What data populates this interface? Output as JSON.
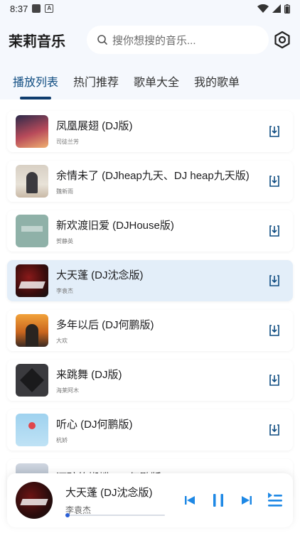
{
  "status": {
    "time": "8:37",
    "a_glyph": "A"
  },
  "app": {
    "title": "茉莉音乐"
  },
  "search": {
    "placeholder": "搜你想搜的音乐..."
  },
  "tabs": [
    {
      "label": "播放列表"
    },
    {
      "label": "热门推荐"
    },
    {
      "label": "歌单大全"
    },
    {
      "label": "我的歌单"
    }
  ],
  "songs": [
    {
      "title": "凤凰展翅 (DJ版)",
      "artist": "司徒兰芳"
    },
    {
      "title": "余情未了 (DJheap九天、DJ heap九天版)",
      "artist": "魏新雨"
    },
    {
      "title": "新欢渡旧爱 (DJHouse版)",
      "artist": "贺静英"
    },
    {
      "title": "大天蓬 (DJ沈念版)",
      "artist": "李袁杰"
    },
    {
      "title": "多年以后 (DJ何鹏版)",
      "artist": "大欢"
    },
    {
      "title": "来跳舞 (DJ版)",
      "artist": "海莱阿木"
    },
    {
      "title": "听心 (DJ何鹏版)",
      "artist": "杭娇"
    },
    {
      "title": "酒醉的蝴蝶 (DJ何鹏版)",
      "artist": ""
    }
  ],
  "player": {
    "title": "大天蓬 (DJ沈念版)",
    "artist": "李袁杰",
    "progress_fraction": 0.02
  },
  "colors": {
    "accent": "#0f4c81",
    "highlight_row": "#e3eef9",
    "control": "#1e88e5"
  }
}
